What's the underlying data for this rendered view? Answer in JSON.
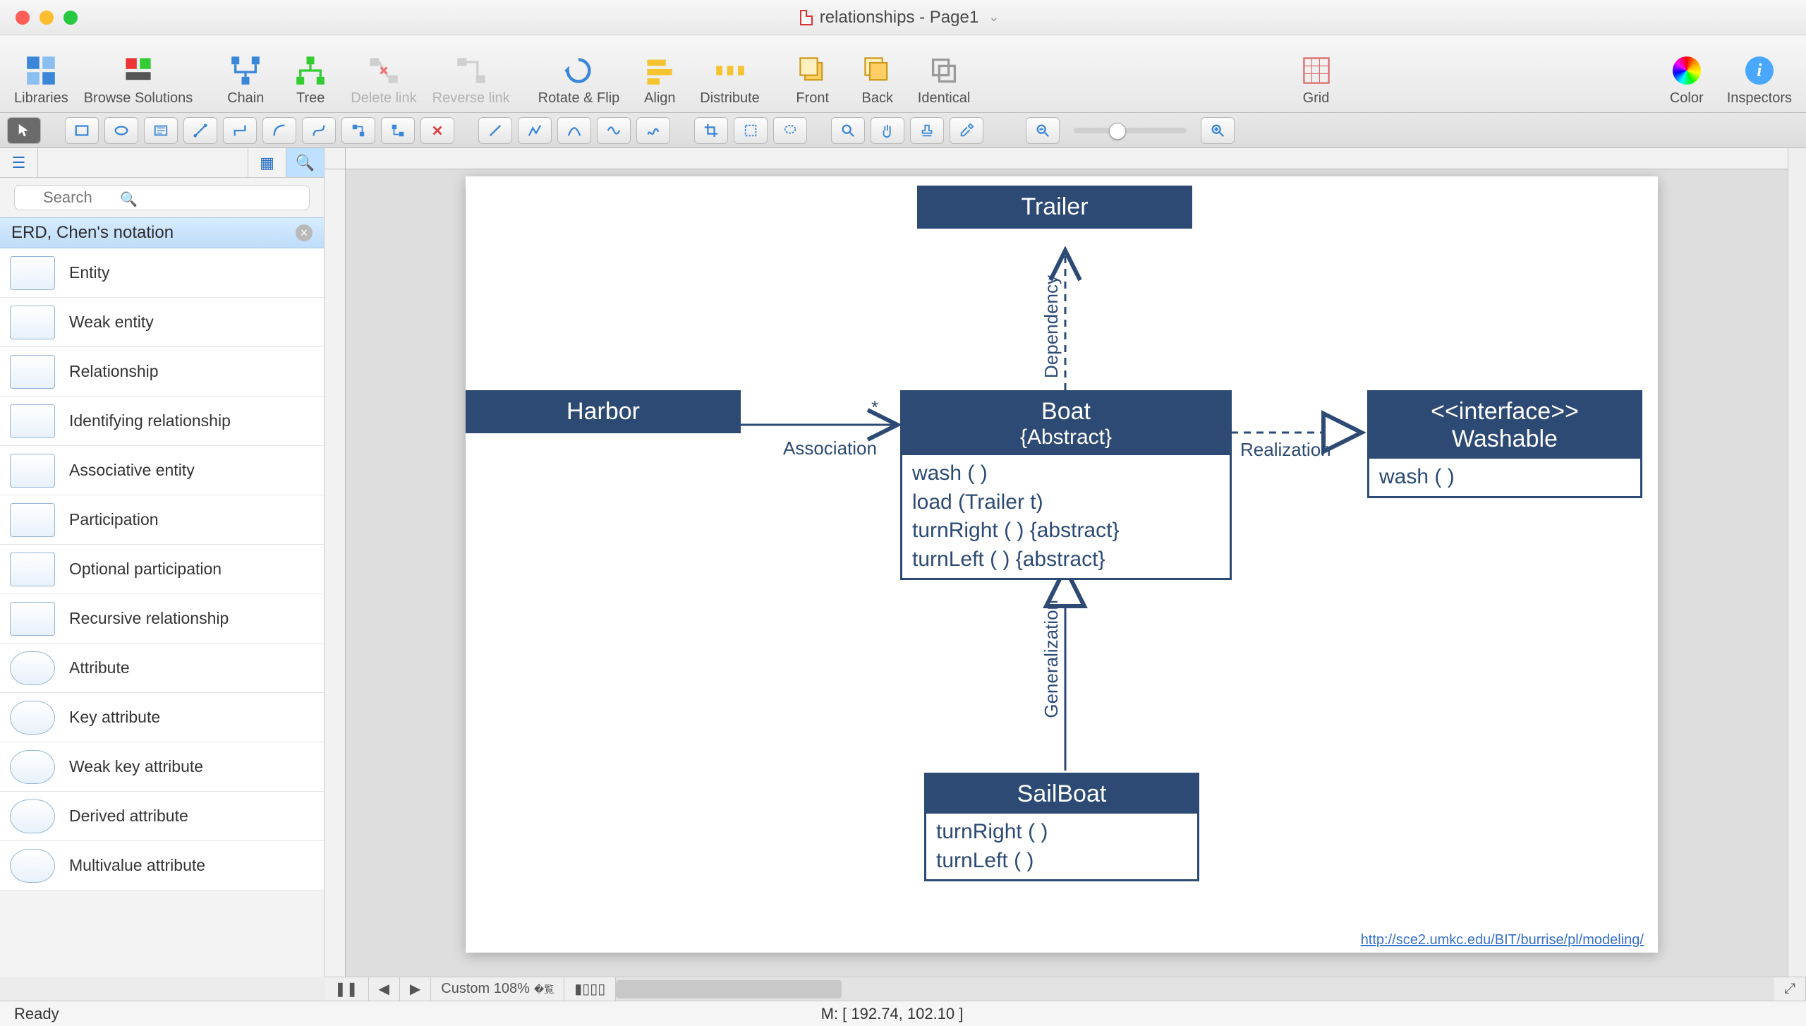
{
  "window": {
    "title": "relationships - Page1"
  },
  "toolbar": {
    "libraries": "Libraries",
    "browse": "Browse Solutions",
    "chain": "Chain",
    "tree": "Tree",
    "delete_link": "Delete link",
    "reverse_link": "Reverse link",
    "rotate": "Rotate & Flip",
    "align": "Align",
    "distribute": "Distribute",
    "front": "Front",
    "back": "Back",
    "identical": "Identical",
    "grid": "Grid",
    "color": "Color",
    "inspectors": "Inspectors"
  },
  "sidebar": {
    "search_placeholder": "Search",
    "section_title": "ERD, Chen's notation",
    "items": [
      "Entity",
      "Weak entity",
      "Relationship",
      "Identifying relationship",
      "Associative entity",
      "Participation",
      "Optional participation",
      "Recursive relationship",
      "Attribute",
      "Key attribute",
      "Weak key attribute",
      "Derived attribute",
      "Multivalue attribute"
    ]
  },
  "diagram": {
    "trailer": {
      "title": "Trailer"
    },
    "harbor": {
      "title": "Harbor"
    },
    "boat": {
      "title": "Boat",
      "subtitle": "{Abstract}",
      "ops": [
        "wash ( )",
        "load (Trailer t)",
        "turnRight ( ) {abstract}",
        "turnLeft ( ) {abstract}"
      ]
    },
    "washable": {
      "stereo": "<<interface>>",
      "title": "Washable",
      "ops": [
        "wash ( )"
      ]
    },
    "sailboat": {
      "title": "SailBoat",
      "ops": [
        "turnRight ( )",
        "turnLeft ( )"
      ]
    },
    "labels": {
      "dependency": "Dependency",
      "association": "Association",
      "star": "*",
      "realization": "Realization",
      "generalization": "Generalization"
    },
    "link": "http://sce2.umkc.edu/BIT/burrise/pl/modeling/"
  },
  "footer": {
    "zoom_label": "Custom 108%",
    "status_left": "Ready",
    "status_mouse": "M: [ 192.74, 102.10 ]"
  },
  "chart_data": {
    "type": "diagram",
    "notation": "UML class diagram",
    "nodes": [
      {
        "id": "Trailer",
        "kind": "class"
      },
      {
        "id": "Harbor",
        "kind": "class"
      },
      {
        "id": "Boat",
        "kind": "class",
        "abstract": true,
        "operations": [
          "wash()",
          "load(Trailer t)",
          "turnRight() {abstract}",
          "turnLeft() {abstract}"
        ]
      },
      {
        "id": "Washable",
        "kind": "interface",
        "operations": [
          "wash()"
        ]
      },
      {
        "id": "SailBoat",
        "kind": "class",
        "operations": [
          "turnRight()",
          "turnLeft()"
        ]
      }
    ],
    "edges": [
      {
        "from": "Boat",
        "to": "Trailer",
        "type": "dependency"
      },
      {
        "from": "Harbor",
        "to": "Boat",
        "type": "association",
        "multiplicity_to": "*"
      },
      {
        "from": "Boat",
        "to": "Washable",
        "type": "realization"
      },
      {
        "from": "SailBoat",
        "to": "Boat",
        "type": "generalization"
      }
    ]
  }
}
